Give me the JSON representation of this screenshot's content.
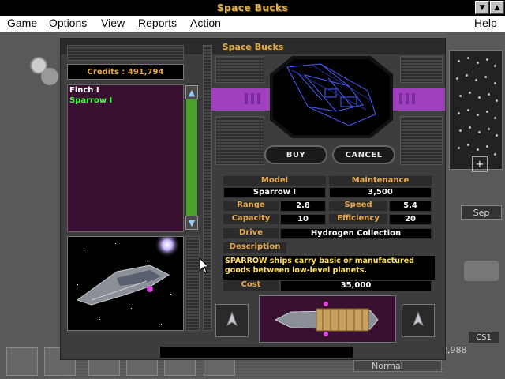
{
  "window": {
    "title": "Space Bucks",
    "minimize": "▼",
    "maximize": "▲"
  },
  "menu": {
    "items": [
      "Game",
      "Options",
      "View",
      "Reports",
      "Action"
    ],
    "help": "Help"
  },
  "background": {
    "month": "Sep",
    "code": "CS1",
    "value": "2,988",
    "speed_mode": "Normal"
  },
  "dialog": {
    "title": "Space Bucks",
    "credits": "Credits : 491,794",
    "ship_list": [
      {
        "name": "Finch I",
        "color": "#ffffff",
        "selected": false
      },
      {
        "name": "Sparrow I",
        "color": "#40ff40",
        "selected": true
      }
    ],
    "buttons": {
      "buy": "BUY",
      "cancel": "CANCEL"
    },
    "specs": {
      "model_label": "Model",
      "model": "Sparrow I",
      "maintenance_label": "Maintenance",
      "maintenance": "3,500",
      "range_label": "Range",
      "range": "2.8",
      "speed_label": "Speed",
      "speed": "5.4",
      "capacity_label": "Capacity",
      "capacity": "10",
      "efficiency_label": "Efficiency",
      "efficiency": "20",
      "drive_label": "Drive",
      "drive": "Hydrogen Collection",
      "description_label": "Description",
      "description": "SPARROW ships carry basic or manufactured goods between low-level planets.",
      "cost_label": "Cost",
      "cost": "35,000"
    }
  },
  "colors": {
    "accent": "#e6a84a",
    "list_bg": "#3a1030",
    "purple_bar": "#a040c0",
    "scrollbar": "#4aa02a"
  }
}
